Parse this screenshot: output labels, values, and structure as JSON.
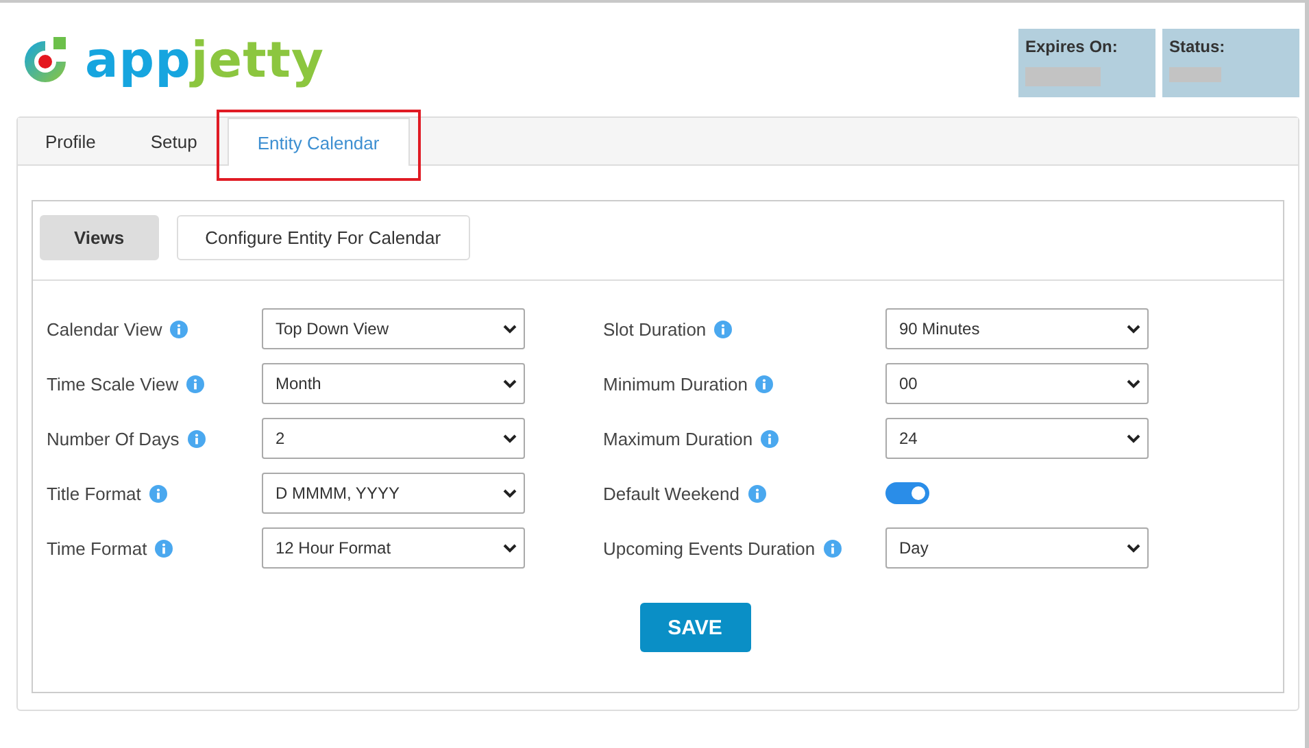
{
  "logo": {
    "first": "app",
    "second": "jetty"
  },
  "license": [
    {
      "label": "Expires On:"
    },
    {
      "label": "Status:"
    }
  ],
  "tabs": [
    {
      "label": "Profile",
      "selected": false,
      "highlighted": false
    },
    {
      "label": "Setup",
      "selected": false,
      "highlighted": false
    },
    {
      "label": "Entity Calendar",
      "selected": true,
      "highlighted": true
    }
  ],
  "subtabs": [
    {
      "label": "Views",
      "selected": true
    },
    {
      "label": "Configure Entity For Calendar",
      "selected": false
    }
  ],
  "left_fields": [
    {
      "label": "Calendar View",
      "kind": "select",
      "value": "Top Down View"
    },
    {
      "label": "Time Scale View",
      "kind": "select",
      "value": "Month"
    },
    {
      "label": "Number Of Days",
      "kind": "select",
      "value": "2"
    },
    {
      "label": "Title Format",
      "kind": "select",
      "value": "D MMMM, YYYY"
    },
    {
      "label": "Time Format",
      "kind": "select",
      "value": "12 Hour Format"
    }
  ],
  "right_fields": [
    {
      "label": "Slot Duration",
      "kind": "select",
      "value": "90 Minutes"
    },
    {
      "label": "Minimum Duration",
      "kind": "select",
      "value": "00"
    },
    {
      "label": "Maximum Duration",
      "kind": "select",
      "value": "24"
    },
    {
      "label": "Default Weekend",
      "kind": "toggle",
      "on": true
    },
    {
      "label": "Upcoming Events Duration",
      "kind": "select",
      "value": "Day"
    }
  ],
  "save_button": "SAVE"
}
